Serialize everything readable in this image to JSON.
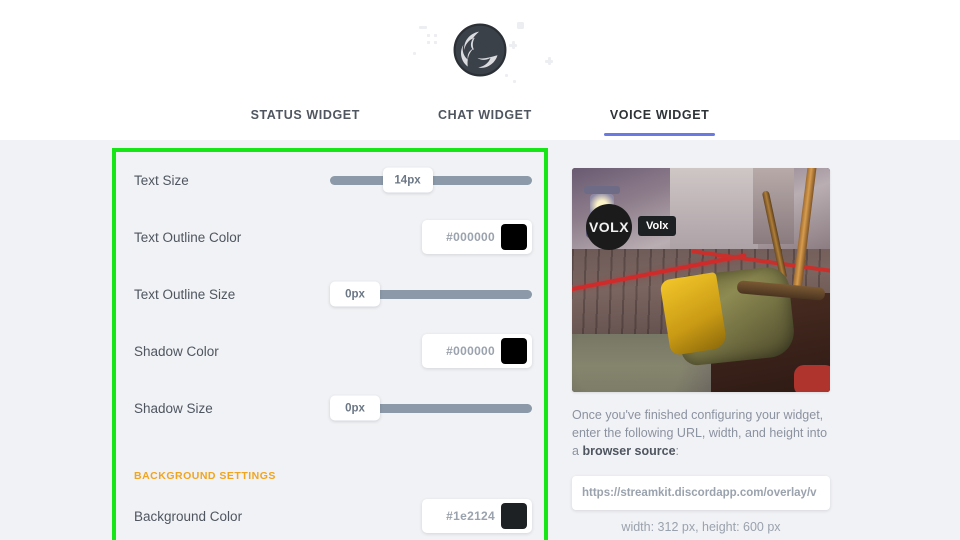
{
  "header": {
    "logo_icon": "obs-logo-icon",
    "logo_alt": "OBS Studio logo"
  },
  "tabs": [
    {
      "label": "STATUS WIDGET",
      "active": false,
      "name": "tab-status-widget"
    },
    {
      "label": "CHAT WIDGET",
      "active": false,
      "name": "tab-chat-widget"
    },
    {
      "label": "VOICE WIDGET",
      "active": true,
      "name": "tab-voice-widget"
    }
  ],
  "form": {
    "highlight_color": "#16e616",
    "rows": [
      {
        "label": "Text Size",
        "control": "slider",
        "value": "14px",
        "fill_percent": 26,
        "name": "text-size"
      },
      {
        "label": "Text Outline Color",
        "control": "color",
        "value": "#000000",
        "swatch": "#000000",
        "name": "text-outline-color"
      },
      {
        "label": "Text Outline Size",
        "control": "slider",
        "value": "0px",
        "fill_percent": 0,
        "name": "text-outline-size"
      },
      {
        "label": "Shadow Color",
        "control": "color",
        "value": "#000000",
        "swatch": "#000000",
        "name": "shadow-color"
      },
      {
        "label": "Shadow Size",
        "control": "slider",
        "value": "0px",
        "fill_percent": 0,
        "name": "shadow-size"
      }
    ],
    "section_heading": "BACKGROUND SETTINGS",
    "background_row": {
      "label": "Background Color",
      "control": "color",
      "value": "#1e2124",
      "swatch": "#1e2124",
      "name": "background-color"
    }
  },
  "preview": {
    "overlay": {
      "avatar_text": "VOLX",
      "username": "Volx"
    },
    "instructions_line1": "Once you've finished configuring your widget,",
    "instructions_line2": "enter the following URL, width, and height into",
    "instructions_line3_pre": "a ",
    "instructions_line3_bold": "browser source",
    "instructions_line3_post": ":",
    "url": "https://streamkit.discordapp.com/overlay/v",
    "dimensions": "width: 312 px, height: 600 px"
  },
  "colors": {
    "accent_tab": "#6a7ae0",
    "section_heading": "#f0a420",
    "page_bg": "#f1f2f5",
    "slider_track": "#8b99a8"
  }
}
